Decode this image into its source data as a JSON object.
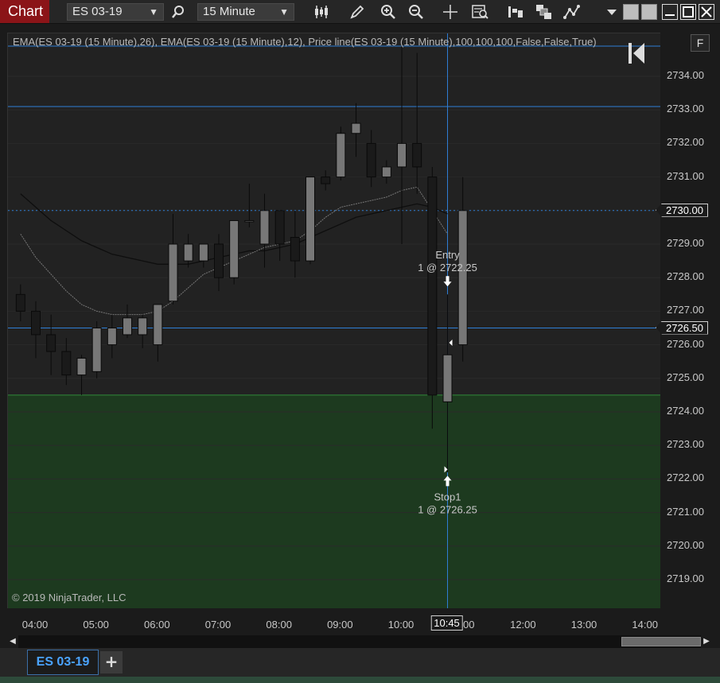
{
  "toolbar": {
    "chart_title": "Chart",
    "instrument": "ES 03-19",
    "interval": "15 Minute"
  },
  "chart": {
    "indicator_label": "EMA(ES 03-19 (15 Minute),26), EMA(ES 03-19 (15 Minute),12), Price line(ES 03-19 (15 Minute),100,100,100,False,False,True)",
    "copyright": "© 2019 NinjaTrader, LLC",
    "entry_label": "Entry",
    "entry_detail": "1 @ 2722.25",
    "stop_label": "Stop1",
    "stop_detail": "1 @ 2726.25"
  },
  "price_axis": {
    "f_button": "F",
    "ticks": [
      "2734.00",
      "2733.00",
      "2732.00",
      "2731.00",
      "2730.00",
      "2729.00",
      "2728.00",
      "2727.00",
      "2726.00",
      "2725.00",
      "2724.00",
      "2723.00",
      "2722.00",
      "2721.00",
      "2720.00",
      "2719.00"
    ],
    "current_price": "2730.00",
    "stop_price": "2726.50"
  },
  "time_axis": {
    "ticks": [
      "04:00",
      "05:00",
      "06:00",
      "07:00",
      "08:00",
      "09:00",
      "10:00",
      "11:00",
      "12:00",
      "13:00",
      "14:00"
    ],
    "cursor_time": "10:45"
  },
  "tabs": {
    "active": "ES 03-19",
    "add": "+"
  },
  "colors": {
    "title_bg": "#8b1418",
    "up_candle": "#777777",
    "down_candle": "#1a1a1a",
    "order_zone": "#1d3a1f",
    "crosshair": "#2e7fd6",
    "tab_text": "#4aa3ff"
  },
  "chart_data": {
    "type": "candlestick",
    "ylim": [
      2718.2,
      2735.2
    ],
    "candles": [
      {
        "t": "03:45",
        "o": 2727.5,
        "h": 2727.8,
        "l": 2726.7,
        "c": 2727.0
      },
      {
        "t": "04:00",
        "o": 2727.0,
        "h": 2727.3,
        "l": 2725.6,
        "c": 2726.3
      },
      {
        "t": "04:15",
        "o": 2726.3,
        "h": 2726.9,
        "l": 2725.1,
        "c": 2725.8
      },
      {
        "t": "04:30",
        "o": 2725.8,
        "h": 2726.2,
        "l": 2724.8,
        "c": 2725.1
      },
      {
        "t": "04:45",
        "o": 2725.1,
        "h": 2725.7,
        "l": 2724.5,
        "c": 2725.6
      },
      {
        "t": "05:00",
        "o": 2725.2,
        "h": 2726.7,
        "l": 2725.0,
        "c": 2726.5
      },
      {
        "t": "05:15",
        "o": 2726.0,
        "h": 2726.9,
        "l": 2725.6,
        "c": 2726.5
      },
      {
        "t": "05:30",
        "o": 2726.3,
        "h": 2727.2,
        "l": 2726.2,
        "c": 2726.8
      },
      {
        "t": "05:45",
        "o": 2726.3,
        "h": 2726.9,
        "l": 2725.9,
        "c": 2726.8
      },
      {
        "t": "06:00",
        "o": 2726.0,
        "h": 2727.2,
        "l": 2725.5,
        "c": 2727.2
      },
      {
        "t": "06:15",
        "o": 2727.3,
        "h": 2729.9,
        "l": 2727.2,
        "c": 2729.0
      },
      {
        "t": "06:30",
        "o": 2728.5,
        "h": 2729.3,
        "l": 2728.3,
        "c": 2729.0
      },
      {
        "t": "06:45",
        "o": 2728.5,
        "h": 2729.0,
        "l": 2728.3,
        "c": 2729.0
      },
      {
        "t": "07:00",
        "o": 2729.0,
        "h": 2729.3,
        "l": 2727.6,
        "c": 2728.0
      },
      {
        "t": "07:15",
        "o": 2728.0,
        "h": 2729.7,
        "l": 2727.8,
        "c": 2729.7
      },
      {
        "t": "07:30",
        "o": 2729.7,
        "h": 2730.8,
        "l": 2729.5,
        "c": 2729.7
      },
      {
        "t": "07:45",
        "o": 2729.0,
        "h": 2730.5,
        "l": 2728.3,
        "c": 2730.0
      },
      {
        "t": "08:00",
        "o": 2730.0,
        "h": 2730.0,
        "l": 2728.5,
        "c": 2729.0
      },
      {
        "t": "08:15",
        "o": 2729.2,
        "h": 2730.0,
        "l": 2728.0,
        "c": 2728.5
      },
      {
        "t": "08:30",
        "o": 2728.5,
        "h": 2731.0,
        "l": 2728.4,
        "c": 2731.0
      },
      {
        "t": "08:45",
        "o": 2731.0,
        "h": 2731.2,
        "l": 2730.6,
        "c": 2730.8
      },
      {
        "t": "09:00",
        "o": 2731.0,
        "h": 2732.5,
        "l": 2730.9,
        "c": 2732.3
      },
      {
        "t": "09:15",
        "o": 2732.3,
        "h": 2733.2,
        "l": 2731.6,
        "c": 2732.6
      },
      {
        "t": "09:30",
        "o": 2732.0,
        "h": 2732.4,
        "l": 2730.7,
        "c": 2731.0
      },
      {
        "t": "09:45",
        "o": 2731.0,
        "h": 2731.5,
        "l": 2730.8,
        "c": 2731.3
      },
      {
        "t": "10:00",
        "o": 2731.3,
        "h": 2735.0,
        "l": 2729.0,
        "c": 2732.0
      },
      {
        "t": "10:15",
        "o": 2732.0,
        "h": 2734.7,
        "l": 2730.5,
        "c": 2731.3
      },
      {
        "t": "10:30",
        "o": 2731.0,
        "h": 2731.3,
        "l": 2723.5,
        "c": 2724.5
      },
      {
        "t": "10:45",
        "o": 2724.3,
        "h": 2727.5,
        "l": 2722.2,
        "c": 2725.7
      },
      {
        "t": "11:00",
        "o": 2726.0,
        "h": 2731.0,
        "l": 2725.5,
        "c": 2730.0
      }
    ],
    "ema26": [
      2730.5,
      2730.1,
      2729.7,
      2729.4,
      2729.1,
      2728.9,
      2728.7,
      2728.6,
      2728.5,
      2728.4,
      2728.4,
      2728.4,
      2728.5,
      2728.6,
      2728.7,
      2728.8,
      2728.8,
      2728.9,
      2729.0,
      2729.2,
      2729.4,
      2729.6,
      2729.8,
      2729.9,
      2730.0,
      2730.1,
      2730.2,
      2730.1,
      2729.9
    ],
    "ema12": [
      2729.3,
      2728.6,
      2728.1,
      2727.6,
      2727.2,
      2727.0,
      2726.9,
      2726.9,
      2726.9,
      2727.0,
      2727.3,
      2727.7,
      2728.1,
      2728.3,
      2728.5,
      2728.7,
      2728.9,
      2729.0,
      2729.1,
      2729.4,
      2729.8,
      2730.1,
      2730.2,
      2730.3,
      2730.4,
      2730.6,
      2730.7,
      2730.0,
      2729.3
    ],
    "price_lines": [
      2734.9,
      2733.1,
      2730.0,
      2726.5
    ],
    "order_zone_top": 2724.5,
    "entry": {
      "time": "10:45",
      "price": 2722.25
    },
    "stop": {
      "time": "10:45",
      "price": 2726.25
    },
    "cursor_time": "10:45"
  }
}
